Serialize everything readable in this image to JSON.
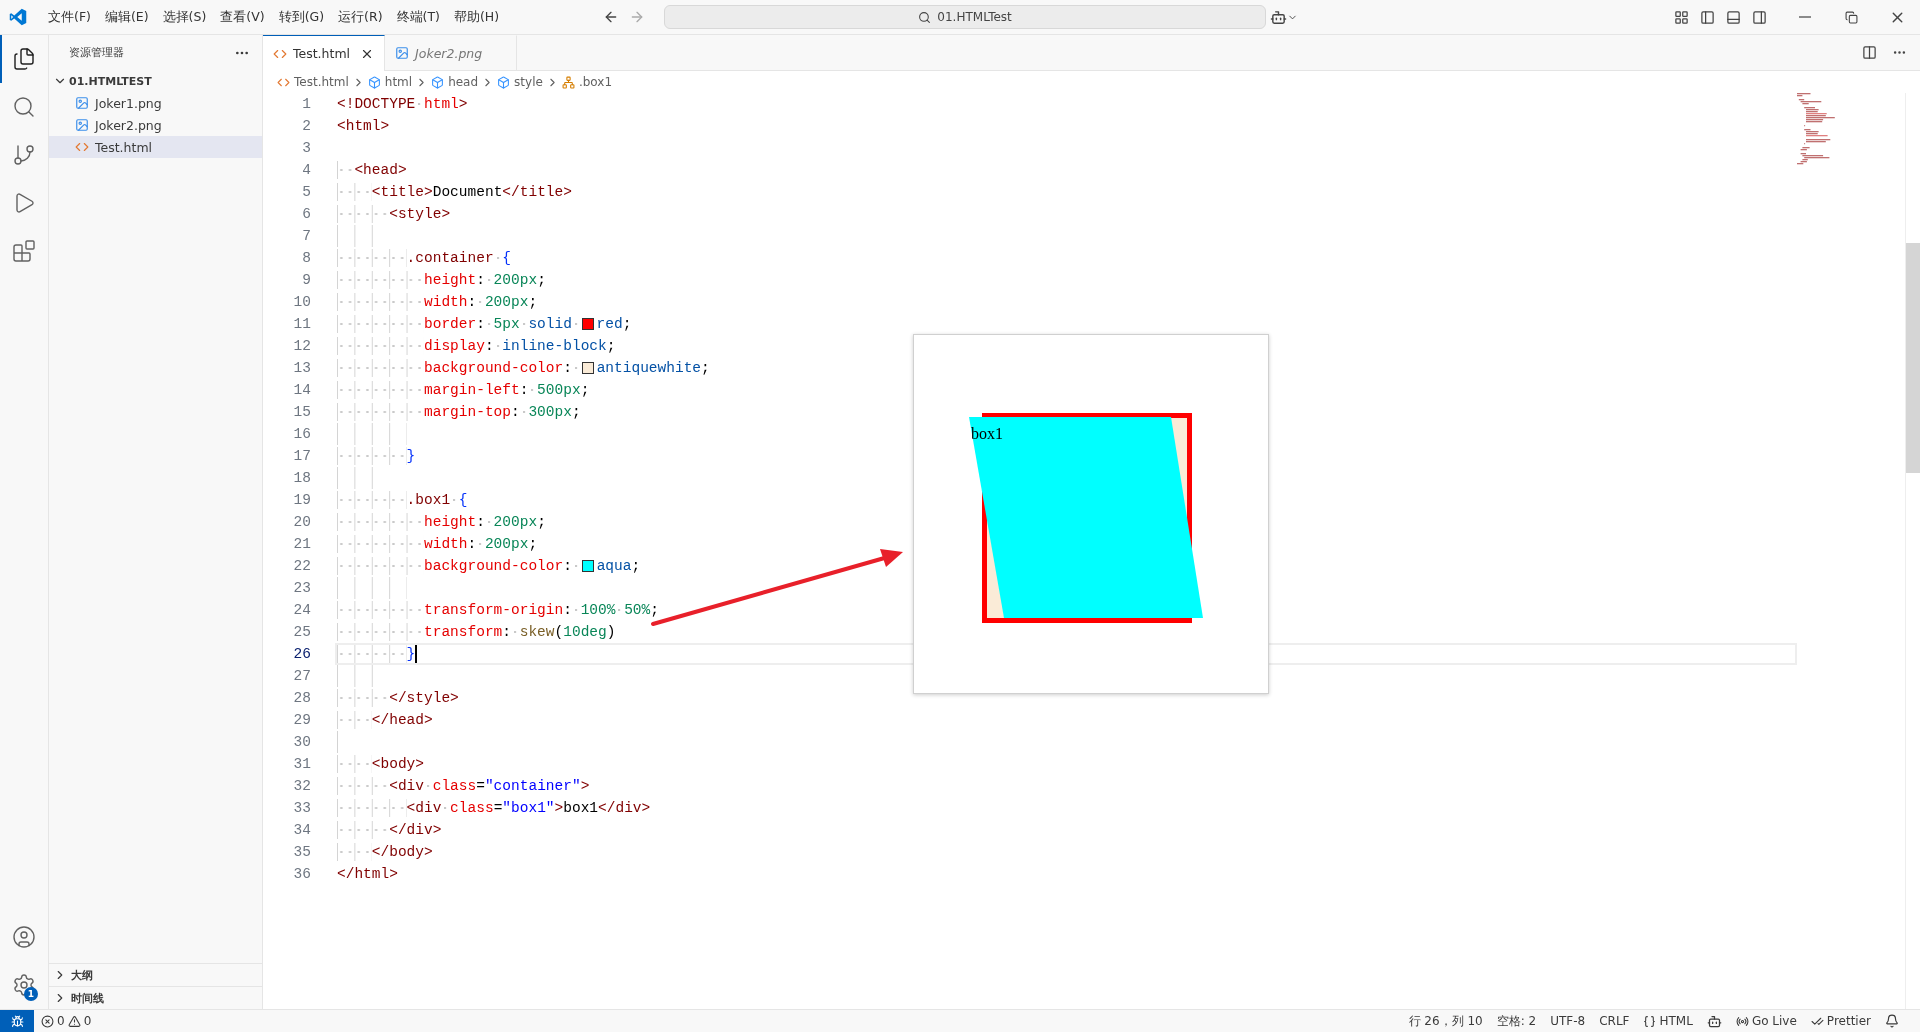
{
  "menu": [
    "文件(F)",
    "编辑(E)",
    "选择(S)",
    "查看(V)",
    "转到(G)",
    "运行(R)",
    "终端(T)",
    "帮助(H)"
  ],
  "command_center": {
    "text": "01.HTMLTest"
  },
  "activity_bar": {
    "top": [
      {
        "kind": "explorer",
        "selected": true
      },
      {
        "kind": "search",
        "selected": false
      },
      {
        "kind": "source-control",
        "selected": false
      },
      {
        "kind": "run",
        "selected": false
      },
      {
        "kind": "extensions",
        "selected": false
      }
    ],
    "bottom": [
      {
        "kind": "account"
      },
      {
        "kind": "settings",
        "badge": "1"
      }
    ]
  },
  "explorer": {
    "title": "资源管理器",
    "folder": {
      "name": "01.HTMLTEST",
      "expanded": true,
      "children": [
        {
          "name": "Joker1.png",
          "kind": "image",
          "selected": false
        },
        {
          "name": "Joker2.png",
          "kind": "image",
          "selected": false
        },
        {
          "name": "Test.html",
          "kind": "html",
          "selected": true
        }
      ]
    },
    "sections": [
      {
        "label": "大纲",
        "expanded": false
      },
      {
        "label": "时间线",
        "expanded": false
      }
    ]
  },
  "tabs": [
    {
      "label": "Test.html",
      "kind": "html",
      "selected": true,
      "preview": false
    },
    {
      "label": "Joker2.png",
      "kind": "image",
      "selected": false,
      "preview": true
    }
  ],
  "breadcrumbs": [
    {
      "label": "Test.html",
      "kind": "html"
    },
    {
      "label": "html",
      "kind": "element"
    },
    {
      "label": "head",
      "kind": "element"
    },
    {
      "label": "style",
      "kind": "element"
    },
    {
      "label": ".box1",
      "kind": "rule"
    }
  ],
  "editor": {
    "lines": [
      {
        "number": "1",
        "current": false,
        "kind": "html",
        "segments": [
          {
            "text": "<!DOCTYPE html>"
          }
        ]
      },
      {
        "number": "2",
        "current": false,
        "kind": "html",
        "segments": [
          {
            "text": "<html>"
          }
        ]
      },
      {
        "number": "3",
        "current": false,
        "kind": "blank"
      },
      {
        "number": "4",
        "current": false,
        "kind": "html",
        "segments": [
          {
            "text": "  <head>"
          }
        ]
      },
      {
        "number": "5",
        "current": false,
        "kind": "html",
        "segments": [
          {
            "text": "    <title>Document</title>"
          }
        ]
      },
      {
        "number": "6",
        "current": false,
        "kind": "html",
        "segments": [
          {
            "text": "      <style>"
          }
        ]
      },
      {
        "number": "7",
        "current": false,
        "kind": "blank"
      },
      {
        "number": "8",
        "current": false,
        "kind": "css",
        "segments": [
          {
            "text": "        .container {"
          }
        ]
      },
      {
        "number": "9",
        "current": false,
        "kind": "css",
        "segments": [
          {
            "text": "          height: 200px;"
          }
        ]
      },
      {
        "number": "10",
        "current": false,
        "kind": "css",
        "segments": [
          {
            "text": "          width: 200px;"
          }
        ]
      },
      {
        "number": "11",
        "current": false,
        "kind": "css",
        "segments": [
          {
            "text": "          border: 5px solid "
          },
          {
            "color": "#ff0000"
          },
          {
            "text": "red;"
          }
        ]
      },
      {
        "number": "12",
        "current": false,
        "kind": "css",
        "segments": [
          {
            "text": "          display: inline-block;"
          }
        ]
      },
      {
        "number": "13",
        "current": false,
        "kind": "css",
        "segments": [
          {
            "text": "          background-color: "
          },
          {
            "color": "#faebd7"
          },
          {
            "text": "antiquewhite;"
          }
        ]
      },
      {
        "number": "14",
        "current": false,
        "kind": "css",
        "segments": [
          {
            "text": "          margin-left: 500px;"
          }
        ]
      },
      {
        "number": "15",
        "current": false,
        "kind": "css",
        "segments": [
          {
            "text": "          margin-top: 300px;"
          }
        ]
      },
      {
        "number": "16",
        "current": false,
        "kind": "blank"
      },
      {
        "number": "17",
        "current": false,
        "kind": "css",
        "segments": [
          {
            "text": "        }"
          }
        ]
      },
      {
        "number": "18",
        "current": false,
        "kind": "blank"
      },
      {
        "number": "19",
        "current": false,
        "kind": "css",
        "segments": [
          {
            "text": "        .box1 {"
          }
        ]
      },
      {
        "number": "20",
        "current": false,
        "kind": "css",
        "segments": [
          {
            "text": "          height: 200px;"
          }
        ]
      },
      {
        "number": "21",
        "current": false,
        "kind": "css",
        "segments": [
          {
            "text": "          width: 200px;"
          }
        ]
      },
      {
        "number": "22",
        "current": false,
        "kind": "css",
        "segments": [
          {
            "text": "          background-color: "
          },
          {
            "color": "#00ffff"
          },
          {
            "text": "aqua;"
          }
        ]
      },
      {
        "number": "23",
        "current": false,
        "kind": "blank"
      },
      {
        "number": "24",
        "current": false,
        "kind": "css",
        "segments": [
          {
            "text": "          transform-origin: 100% 50%;"
          }
        ]
      },
      {
        "number": "25",
        "current": false,
        "kind": "css",
        "segments": [
          {
            "text": "          transform: skew(10deg)"
          }
        ]
      },
      {
        "number": "26",
        "current": true,
        "kind": "css",
        "segments": [
          {
            "text": "        }"
          }
        ]
      },
      {
        "number": "27",
        "current": false,
        "kind": "blank"
      },
      {
        "number": "28",
        "current": false,
        "kind": "html",
        "segments": [
          {
            "text": "      </style>"
          }
        ]
      },
      {
        "number": "29",
        "current": false,
        "kind": "html",
        "segments": [
          {
            "text": "    </head>"
          }
        ]
      },
      {
        "number": "30",
        "current": false,
        "kind": "blank"
      },
      {
        "number": "31",
        "current": false,
        "kind": "html",
        "segments": [
          {
            "text": "    <body>"
          }
        ]
      },
      {
        "number": "32",
        "current": false,
        "kind": "html",
        "segments": [
          {
            "text": "      <div class=\"container\">"
          }
        ]
      },
      {
        "number": "33",
        "current": false,
        "kind": "html",
        "segments": [
          {
            "text": "        <div class=\"box1\">box1</div>"
          }
        ]
      },
      {
        "number": "34",
        "current": false,
        "kind": "html",
        "segments": [
          {
            "text": "      </div>"
          }
        ]
      },
      {
        "number": "35",
        "current": false,
        "kind": "html",
        "segments": [
          {
            "text": "    </body>"
          }
        ]
      },
      {
        "number": "36",
        "current": false,
        "kind": "html",
        "segments": [
          {
            "text": "</html>"
          }
        ]
      }
    ]
  },
  "preview": {
    "box_text": "box1"
  },
  "status_bar": {
    "errors": "0",
    "warnings": "0",
    "right": [
      {
        "kind": "text",
        "label": "行 26，列 10"
      },
      {
        "kind": "text",
        "label": "空格: 2"
      },
      {
        "kind": "text",
        "label": "UTF-8"
      },
      {
        "kind": "text",
        "label": "CRLF"
      },
      {
        "kind": "language",
        "label": "HTML"
      },
      {
        "kind": "copilot"
      },
      {
        "kind": "golive",
        "label": "Go Live"
      },
      {
        "kind": "prettier",
        "label": "Prettier"
      },
      {
        "kind": "bell"
      }
    ]
  }
}
